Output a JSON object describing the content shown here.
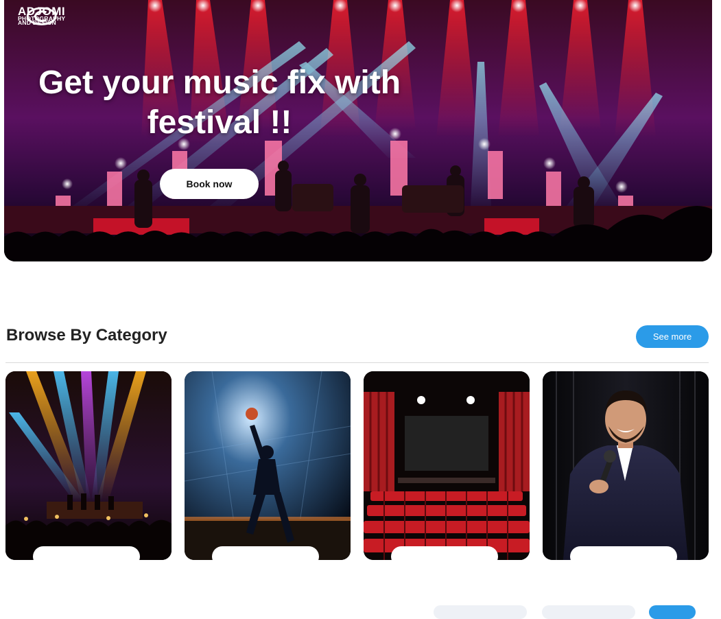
{
  "hero": {
    "logo_brand": "ADJOMI",
    "logo_sub1": "PHOTOGRAPHY",
    "logo_sub2": "AND DESIGN",
    "title_line1": "Get your music fix with",
    "title_line2": "festival !!",
    "cta_label": "Book now"
  },
  "category_section": {
    "title": "Browse By Category",
    "see_more_label": "See more"
  },
  "categories": [
    {
      "icon": "concert-image"
    },
    {
      "icon": "basketball-image"
    },
    {
      "icon": "cinema-image"
    },
    {
      "icon": "comedy-image"
    }
  ],
  "colors": {
    "accent": "#2b9be8",
    "hero_bg": "#0d0418",
    "stage_red": "#e0203a",
    "beam_cyan": "#6fe6ff",
    "beam_purple": "#b05cff"
  }
}
